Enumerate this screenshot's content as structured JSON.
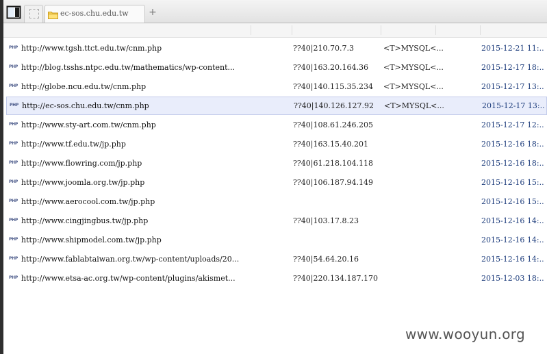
{
  "tabs": {
    "active_tab_label": "ec-sos.chu.edu.tw",
    "new_tab_symbol": "+"
  },
  "rows": [
    {
      "url": "http://www.tgsh.ttct.edu.tw/cnm.php",
      "ip": "??40|210.70.7.3",
      "db": "<T>MYSQL<...",
      "date": "2015-12-21 11:..",
      "selected": false
    },
    {
      "url": "http://blog.tsshs.ntpc.edu.tw/mathematics/wp-content...",
      "ip": "??40|163.20.164.36",
      "db": "<T>MYSQL<...",
      "date": "2015-12-17 18:..",
      "selected": false
    },
    {
      "url": "http://globe.ncu.edu.tw/cnm.php",
      "ip": "??40|140.115.35.234",
      "db": "<T>MYSQL<...",
      "date": "2015-12-17 13:..",
      "selected": false
    },
    {
      "url": "http://ec-sos.chu.edu.tw/cnm.php",
      "ip": "??40|140.126.127.92",
      "db": "<T>MYSQL<...",
      "date": "2015-12-17 13:..",
      "selected": true
    },
    {
      "url": "http://www.sty-art.com.tw/cnm.php",
      "ip": "??40|108.61.246.205",
      "db": "",
      "date": "2015-12-17 12:..",
      "selected": false
    },
    {
      "url": "http://www.tf.edu.tw/jp.php",
      "ip": "??40|163.15.40.201",
      "db": "",
      "date": "2015-12-16 18:..",
      "selected": false
    },
    {
      "url": "http://www.flowring.com/jp.php",
      "ip": "??40|61.218.104.118",
      "db": "",
      "date": "2015-12-16 18:..",
      "selected": false
    },
    {
      "url": "http://www.joomla.org.tw/jp.php",
      "ip": "??40|106.187.94.149",
      "db": "",
      "date": "2015-12-16 15:..",
      "selected": false
    },
    {
      "url": "http://www.aerocool.com.tw/jp.php",
      "ip": "",
      "db": "",
      "date": "2015-12-16 15:..",
      "selected": false
    },
    {
      "url": "http://www.cingjingbus.tw/jp.php",
      "ip": "??40|103.17.8.23",
      "db": "",
      "date": "2015-12-16 14:..",
      "selected": false
    },
    {
      "url": "http://www.shipmodel.com.tw/jp.php",
      "ip": "",
      "db": "",
      "date": "2015-12-16 14:..",
      "selected": false
    },
    {
      "url": "http://www.fablabtaiwan.org.tw/wp-content/uploads/20...",
      "ip": "??40|54.64.20.16",
      "db": "",
      "date": "2015-12-16 14:..",
      "selected": false
    },
    {
      "url": "http://www.etsa-ac.org.tw/wp-content/plugins/akismet...",
      "ip": "??40|220.134.187.170",
      "db": "",
      "date": "2015-12-03 18:..",
      "selected": false
    }
  ],
  "row_icon_label": "PHP",
  "watermark": "www.wooyun.org",
  "colors": {
    "selected_row_bg": "#e9edfb",
    "date_text": "#1a3a7a"
  },
  "icons": {
    "sidebar_toggle": "panel-toggle-icon",
    "blank_tab": "blank-page-icon",
    "tab_folder": "folder-icon",
    "row_icon": "php-file-icon"
  }
}
